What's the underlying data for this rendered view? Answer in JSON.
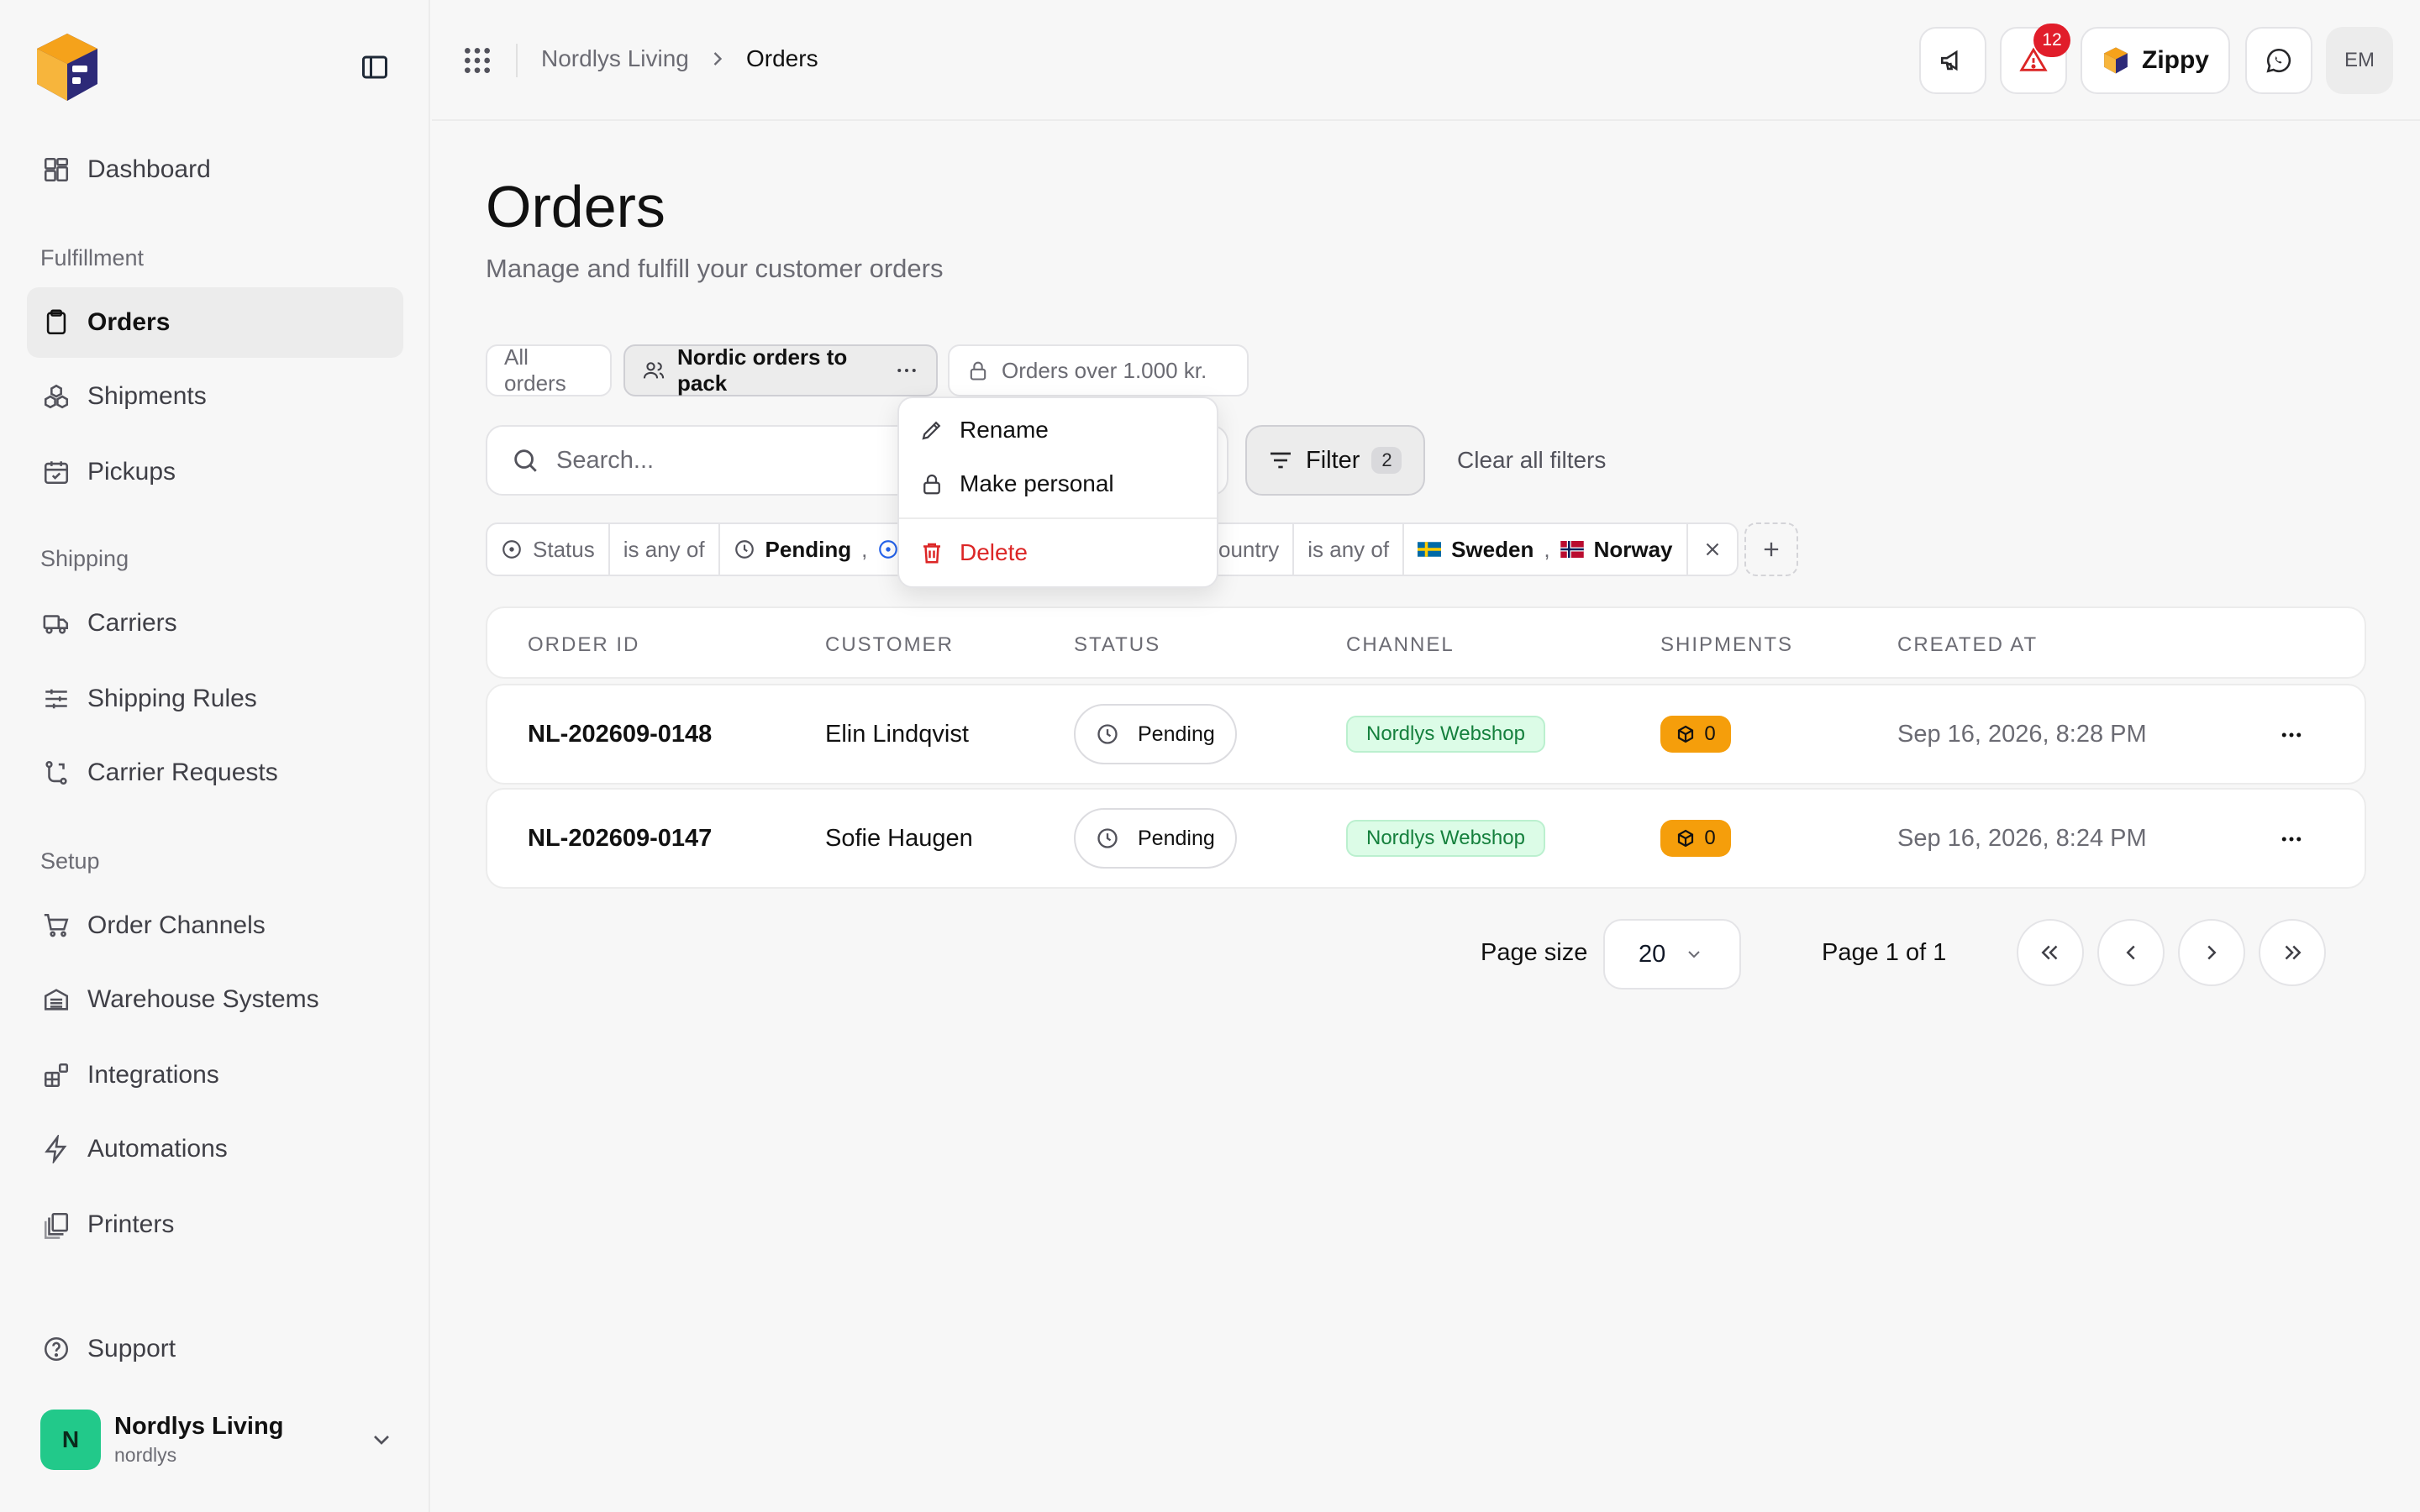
{
  "app": {
    "workspace": "Nordlys Living",
    "workspace_handle": "nordlys",
    "workspace_initial": "N",
    "user_initials": "EM",
    "alerts_count": "12",
    "assistant_label": "Zippy"
  },
  "breadcrumb": {
    "parent": "Nordlys Living",
    "current": "Orders"
  },
  "sidebar": {
    "dashboard": "Dashboard",
    "sections": {
      "fulfillment": "Fulfillment",
      "shipping": "Shipping",
      "setup": "Setup"
    },
    "items": {
      "orders": "Orders",
      "shipments": "Shipments",
      "pickups": "Pickups",
      "carriers": "Carriers",
      "shipping_rules": "Shipping Rules",
      "carrier_requests": "Carrier Requests",
      "order_channels": "Order Channels",
      "warehouse_systems": "Warehouse Systems",
      "integrations": "Integrations",
      "automations": "Automations",
      "printers": "Printers",
      "support": "Support"
    }
  },
  "page": {
    "title": "Orders",
    "subtitle": "Manage and fulfill your customer orders"
  },
  "views": {
    "all": "All orders",
    "active": "Nordic orders to pack",
    "other": "Orders over 1.000 kr."
  },
  "view_menu": {
    "rename": "Rename",
    "make_personal": "Make personal",
    "delete": "Delete"
  },
  "search": {
    "placeholder": "Search..."
  },
  "filter": {
    "label": "Filter",
    "count": "2",
    "clear_all": "Clear all filters"
  },
  "filters": {
    "status": {
      "field": "Status",
      "operator": "is any of",
      "value": "Pending",
      "separator": ","
    },
    "country": {
      "field": "Country",
      "field_visible": "ountry",
      "operator": "is any of",
      "values": [
        "Sweden",
        "Norway"
      ],
      "separator": ","
    }
  },
  "table": {
    "columns": [
      "ORDER ID",
      "CUSTOMER",
      "STATUS",
      "CHANNEL",
      "SHIPMENTS",
      "CREATED AT"
    ],
    "rows": [
      {
        "order_id": "NL-202609-0148",
        "customer": "Elin Lindqvist",
        "status": "Pending",
        "channel": "Nordlys Webshop",
        "shipments": "0",
        "created_at": "Sep 16, 2026, 8:28 PM"
      },
      {
        "order_id": "NL-202609-0147",
        "customer": "Sofie Haugen",
        "status": "Pending",
        "channel": "Nordlys Webshop",
        "shipments": "0",
        "created_at": "Sep 16, 2026, 8:24 PM"
      }
    ]
  },
  "pagination": {
    "page_size_label": "Page size",
    "page_size": "20",
    "page_info": "Page 1 of 1"
  },
  "colors": {
    "accent_logo_orange": "#f5a21b",
    "accent_logo_navy": "#2d2a78",
    "danger": "#dc2626",
    "success_bg": "#dcfce7",
    "shipments_badge": "#f59e0b",
    "avatar_green": "#22c98a"
  },
  "icons": [
    "panel-toggle-icon",
    "dashboard-icon",
    "clipboard-icon",
    "boxes-icon",
    "calendar-check-icon",
    "truck-icon",
    "sliders-icon",
    "route-icon",
    "cart-icon",
    "warehouse-icon",
    "blocks-icon",
    "zap-icon",
    "printer-icon",
    "help-circle-icon",
    "chevron-down-icon",
    "apps-grid-icon",
    "megaphone-icon",
    "alert-triangle-icon",
    "chat-icon",
    "users-icon",
    "lock-icon",
    "more-horizontal-icon",
    "pencil-icon",
    "trash-icon",
    "search-icon",
    "filter-lines-icon",
    "circle-dot-icon",
    "clock-icon",
    "x-icon",
    "plus-icon",
    "package-icon",
    "chevrons-left-icon",
    "chevron-left-icon",
    "chevron-right-icon",
    "chevrons-right-icon"
  ]
}
